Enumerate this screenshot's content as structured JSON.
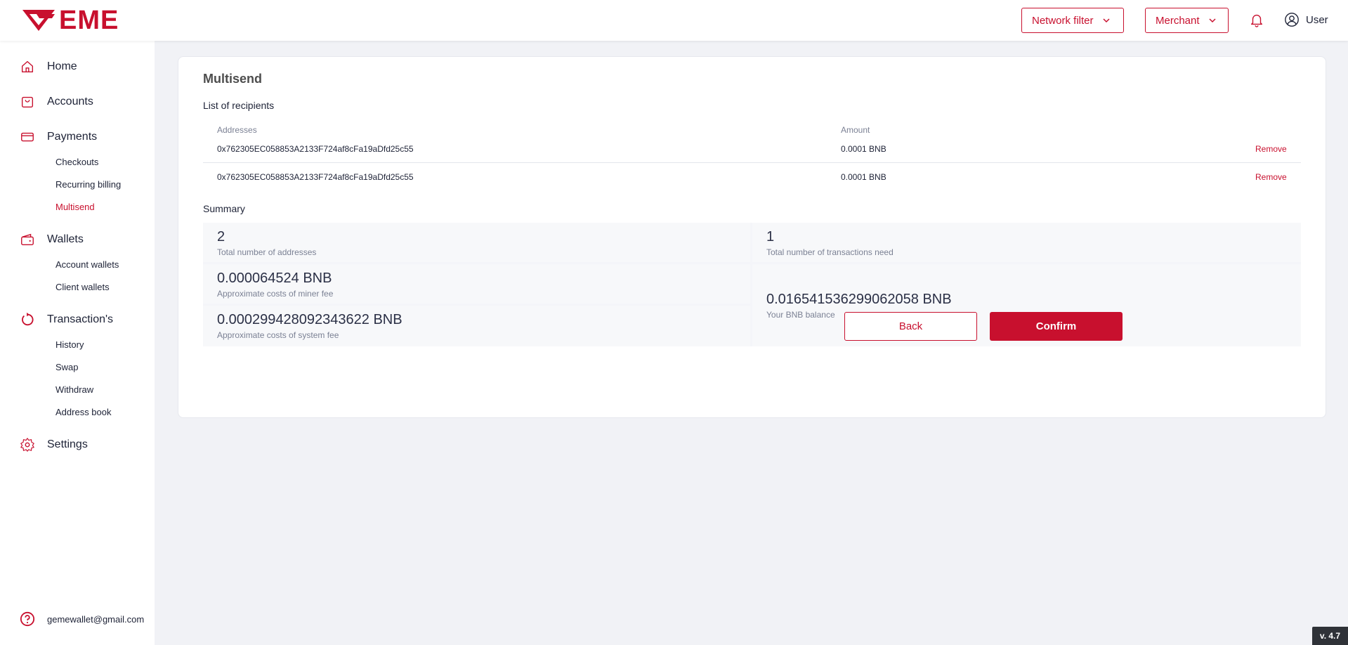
{
  "brand": {
    "name": "EME",
    "color": "#c8102e"
  },
  "header": {
    "network_filter_label": "Network filter",
    "merchant_label": "Merchant",
    "user_label": "User"
  },
  "sidebar": {
    "home": "Home",
    "accounts": "Accounts",
    "payments": "Payments",
    "checkouts": "Checkouts",
    "recurring_billing": "Recurring billing",
    "multisend": "Multisend",
    "wallets": "Wallets",
    "account_wallets": "Account wallets",
    "client_wallets": "Client wallets",
    "transactions": "Transaction's",
    "history": "History",
    "swap": "Swap",
    "withdraw": "Withdraw",
    "address_book": "Address book",
    "settings": "Settings",
    "email": "gemewallet@gmail.com"
  },
  "main": {
    "title": "Multisend",
    "recipients_title": "List of recipients",
    "col_addresses": "Addresses",
    "col_amount": "Amount",
    "rows": [
      {
        "address": "0x762305EC058853A2133F724af8cFa19aDfd25c55",
        "amount": "0.0001 BNB",
        "action": "Remove"
      },
      {
        "address": "0x762305EC058853A2133F724af8cFa19aDfd25c55",
        "amount": "0.0001 BNB",
        "action": "Remove"
      }
    ],
    "summary_title": "Summary",
    "summary": {
      "total_addresses_value": "2",
      "total_addresses_label": "Total number of addresses",
      "total_tx_value": "1",
      "total_tx_label": "Total number of transactions need",
      "miner_fee_value": "0.000064524 BNB",
      "miner_fee_label": "Approximate costs of miner fee",
      "system_fee_value": "0.000299428092343622 BNB",
      "system_fee_label": "Approximate costs of system fee",
      "balance_value": "0.016541536299062058 BNB",
      "balance_label": "Your BNB balance"
    },
    "back_label": "Back",
    "confirm_label": "Confirm"
  },
  "version": "v. 4.7",
  "icons": [
    "gem-logo-icon",
    "chevron-down-icon",
    "bell-icon",
    "user-icon",
    "home-icon",
    "bag-icon",
    "card-icon",
    "wallet-icon",
    "refresh-icon",
    "gear-icon",
    "help-icon"
  ]
}
